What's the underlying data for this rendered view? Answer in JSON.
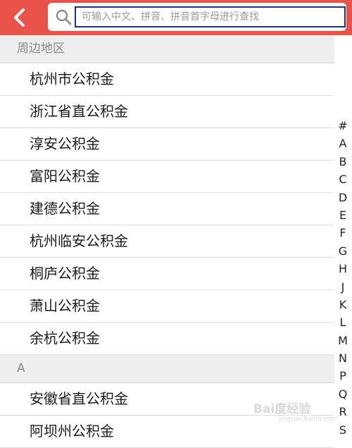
{
  "search": {
    "placeholder": "可输入中文、拼音、拼音首字母进行查找"
  },
  "sections": [
    {
      "header": "周边地区",
      "items": [
        "杭州市公积金",
        "浙江省直公积金",
        "淳安公积金",
        "富阳公积金",
        "建德公积金",
        "杭州临安公积金",
        "桐庐公积金",
        "萧山公积金",
        "余杭公积金"
      ]
    },
    {
      "header": "A",
      "items": [
        "安徽省直公积金",
        "阿坝州公积金"
      ]
    }
  ],
  "index": [
    "#",
    "A",
    "B",
    "C",
    "D",
    "E",
    "F",
    "G",
    "H",
    "J",
    "K",
    "L",
    "M",
    "N",
    "P",
    "Q",
    "R",
    "S"
  ],
  "watermark": {
    "main": "Bai度经验",
    "sub": "jingyan.baidu.com"
  },
  "colors": {
    "topbar": "#e9534a",
    "search_highlight": "#1b2fa8"
  },
  "icons": {
    "back": "chevron-left-icon",
    "search": "search-icon"
  }
}
